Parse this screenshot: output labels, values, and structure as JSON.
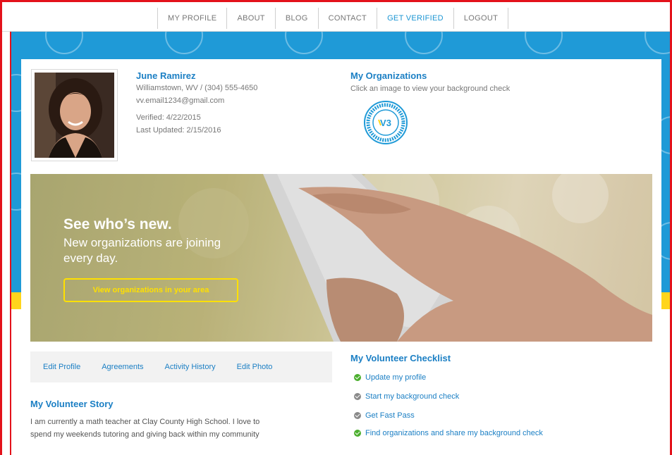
{
  "nav": {
    "items": [
      {
        "label": "MY PROFILE",
        "active": false
      },
      {
        "label": "ABOUT",
        "active": false
      },
      {
        "label": "BLOG",
        "active": false
      },
      {
        "label": "CONTACT",
        "active": false
      },
      {
        "label": "GET VERIFIED",
        "active": true
      },
      {
        "label": "LOGOUT",
        "active": false
      }
    ]
  },
  "colors": {
    "brand_blue": "#1f9ad7",
    "link_blue": "#1b7fc4",
    "yellow": "#ffd51c",
    "check_green": "#4caf2f",
    "check_gray": "#8a8a8a"
  },
  "profile": {
    "name": "June Ramirez",
    "location_phone": "Williamstown, WV / (304) 555-4650",
    "email": "vv.email1234@gmail.com",
    "verified": "Verified:  4/22/2015",
    "last_updated": "Last Updated:  2/15/2016"
  },
  "organizations": {
    "title": "My Organizations",
    "subtitle": "Click an image to view your background check",
    "badge_text": "V3",
    "badge_icon": "verified-seal-icon"
  },
  "hero": {
    "title": "See who’s new.",
    "line1": "New organizations are joining",
    "line2": "every day.",
    "button": "View organizations in your area"
  },
  "tabs": [
    "Edit Profile",
    "Agreements",
    "Activity History",
    "Edit Photo"
  ],
  "story": {
    "title": "My Volunteer Story",
    "line1": "I am currently a math teacher at Clay County High School. I love to",
    "line2": "spend my weekends tutoring and giving back within my community"
  },
  "checklist": {
    "title": "My Volunteer Checklist",
    "items": [
      {
        "label": "Update my profile",
        "status": "done"
      },
      {
        "label": "Start my background check",
        "status": "pending"
      },
      {
        "label": "Get Fast Pass",
        "status": "pending"
      },
      {
        "label": "Find organizations and share my background check",
        "status": "done"
      }
    ]
  }
}
